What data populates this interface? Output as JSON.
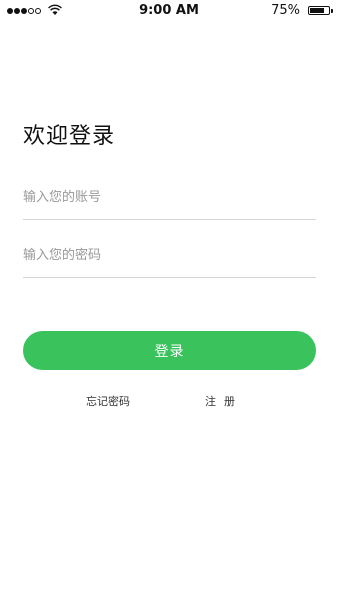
{
  "status_bar": {
    "time": "9:00 AM",
    "battery_percent": "75%",
    "signal_bars_filled": 3,
    "signal_bars_total": 5,
    "battery_level": 0.75,
    "icons": [
      "signal-dots-icon",
      "wifi-icon",
      "battery-icon"
    ]
  },
  "login": {
    "title": "欢迎登录",
    "account_placeholder": "输入您的账号",
    "password_placeholder": "输入您的密码",
    "login_button": "登录",
    "forgot_password": "忘记密码",
    "register": "注册"
  },
  "colors": {
    "primary_green": "#3ac35d",
    "divider": "#d6d6d6",
    "placeholder_text": "#999999"
  }
}
